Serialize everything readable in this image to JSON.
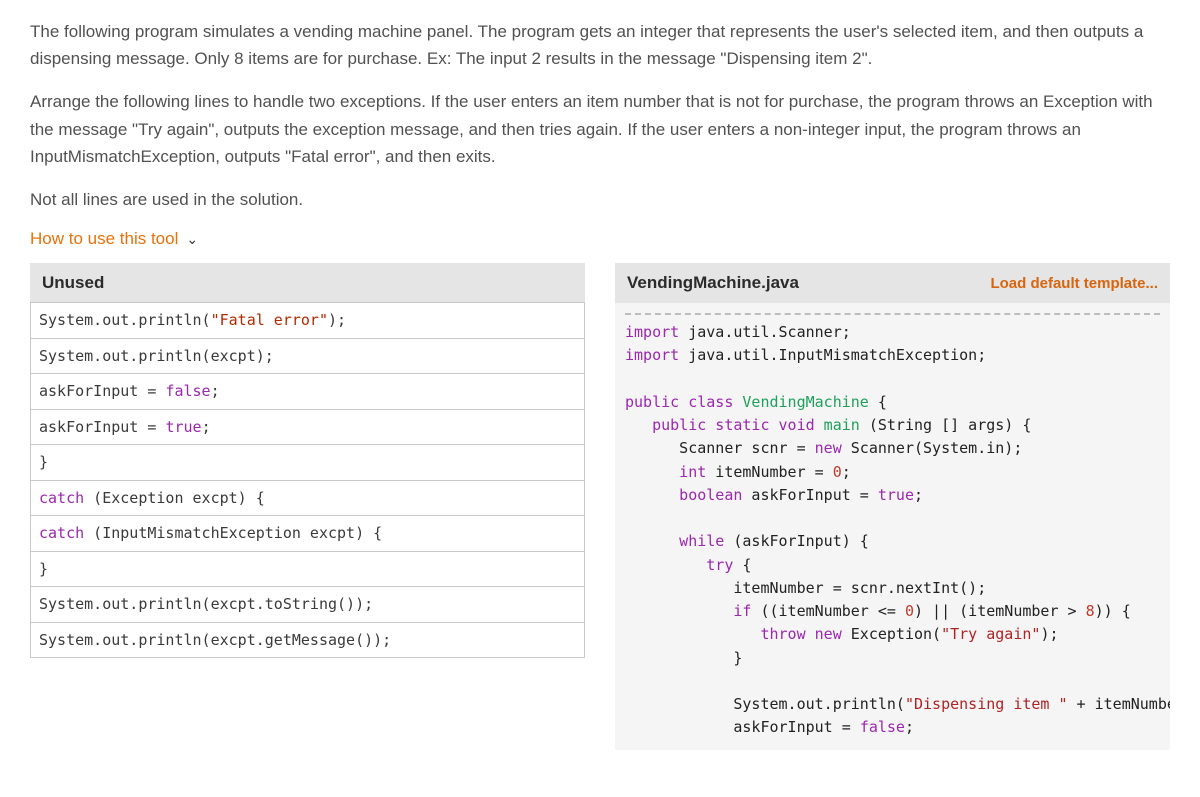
{
  "description": {
    "p1": "The following program simulates a vending machine panel. The program gets an integer that represents the user's selected item, and then outputs a dispensing message. Only 8 items are for purchase. Ex: The input 2 results in the message \"Dispensing item 2\".",
    "p2": "Arrange the following lines to handle two exceptions. If the user enters an item number that is not for purchase, the program throws an Exception with the message \"Try again\", outputs the exception message, and then tries again. If the user enters a non-integer input, the program throws an InputMismatchException, outputs \"Fatal error\", and then exits.",
    "p3": "Not all lines are used in the solution."
  },
  "howto": "How to use this tool",
  "unused": {
    "header": "Unused",
    "items": [
      "System.out.println(\"Fatal error\");",
      "System.out.println(excpt);",
      "askForInput = false;",
      "askForInput = true;",
      "}",
      "catch (Exception excpt) {",
      "catch (InputMismatchException excpt) {",
      "}",
      "System.out.println(excpt.toString());",
      "System.out.println(excpt.getMessage());"
    ]
  },
  "editor": {
    "filename": "VendingMachine.java",
    "load_label": "Load default template..."
  },
  "code": {
    "l1a": "import",
    "l1b": " java.util.Scanner;",
    "l2a": "import",
    "l2b": " java.util.InputMismatchException;",
    "l4a": "public",
    "l4b": " class",
    "l4c": " VendingMachine",
    "l4d": " {",
    "l5a": "   public",
    "l5b": " static",
    "l5c": " void",
    "l5d": " main",
    "l5e": " (String [] args) {",
    "l6a": "      Scanner scnr = ",
    "l6b": "new",
    "l6c": " Scanner(System.in);",
    "l7a": "      int",
    "l7b": " itemNumber = ",
    "l7c": "0",
    "l7d": ";",
    "l8a": "      boolean",
    "l8b": " askForInput = ",
    "l8c": "true",
    "l8d": ";",
    "l10a": "      while",
    "l10b": " (askForInput) {",
    "l11a": "         try",
    "l11b": " {",
    "l12": "            itemNumber = scnr.nextInt();",
    "l13a": "            if",
    "l13b": " ((itemNumber <= ",
    "l13c": "0",
    "l13d": ") || (itemNumber > ",
    "l13e": "8",
    "l13f": ")) {",
    "l14a": "               throw",
    "l14b": " new",
    "l14c": " Exception(",
    "l14d": "\"Try again\"",
    "l14e": ");",
    "l15": "            }",
    "l17a": "            System.out.println(",
    "l17b": "\"Dispensing item \"",
    "l17c": " + itemNumbe",
    "l18a": "            askForInput = ",
    "l18b": "false",
    "l18c": ";"
  }
}
